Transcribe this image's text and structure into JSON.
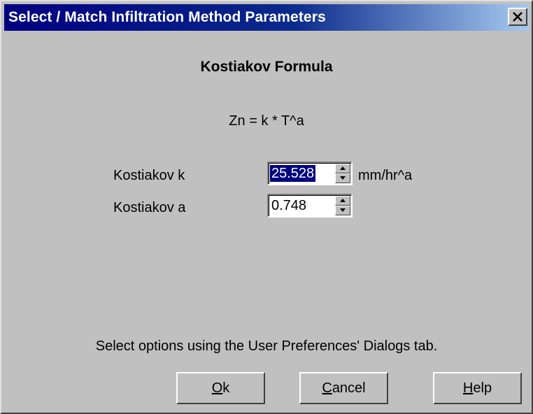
{
  "window": {
    "title": "Select / Match Infiltration Method Parameters"
  },
  "heading": "Kostiakov Formula",
  "formula": "Zn = k * T^a",
  "fields": [
    {
      "label": "Kostiakov k",
      "value": "25.528",
      "unit": "mm/hr^a",
      "selected": true
    },
    {
      "label": "Kostiakov a",
      "value": "0.748",
      "unit": ""
    }
  ],
  "info_text": "Select options using the User Preferences' Dialogs tab.",
  "buttons": {
    "ok": {
      "mnemonic": "O",
      "rest": "k"
    },
    "cancel": {
      "mnemonic": "C",
      "rest": "ancel"
    },
    "help": {
      "mnemonic": "H",
      "rest": "elp"
    }
  }
}
